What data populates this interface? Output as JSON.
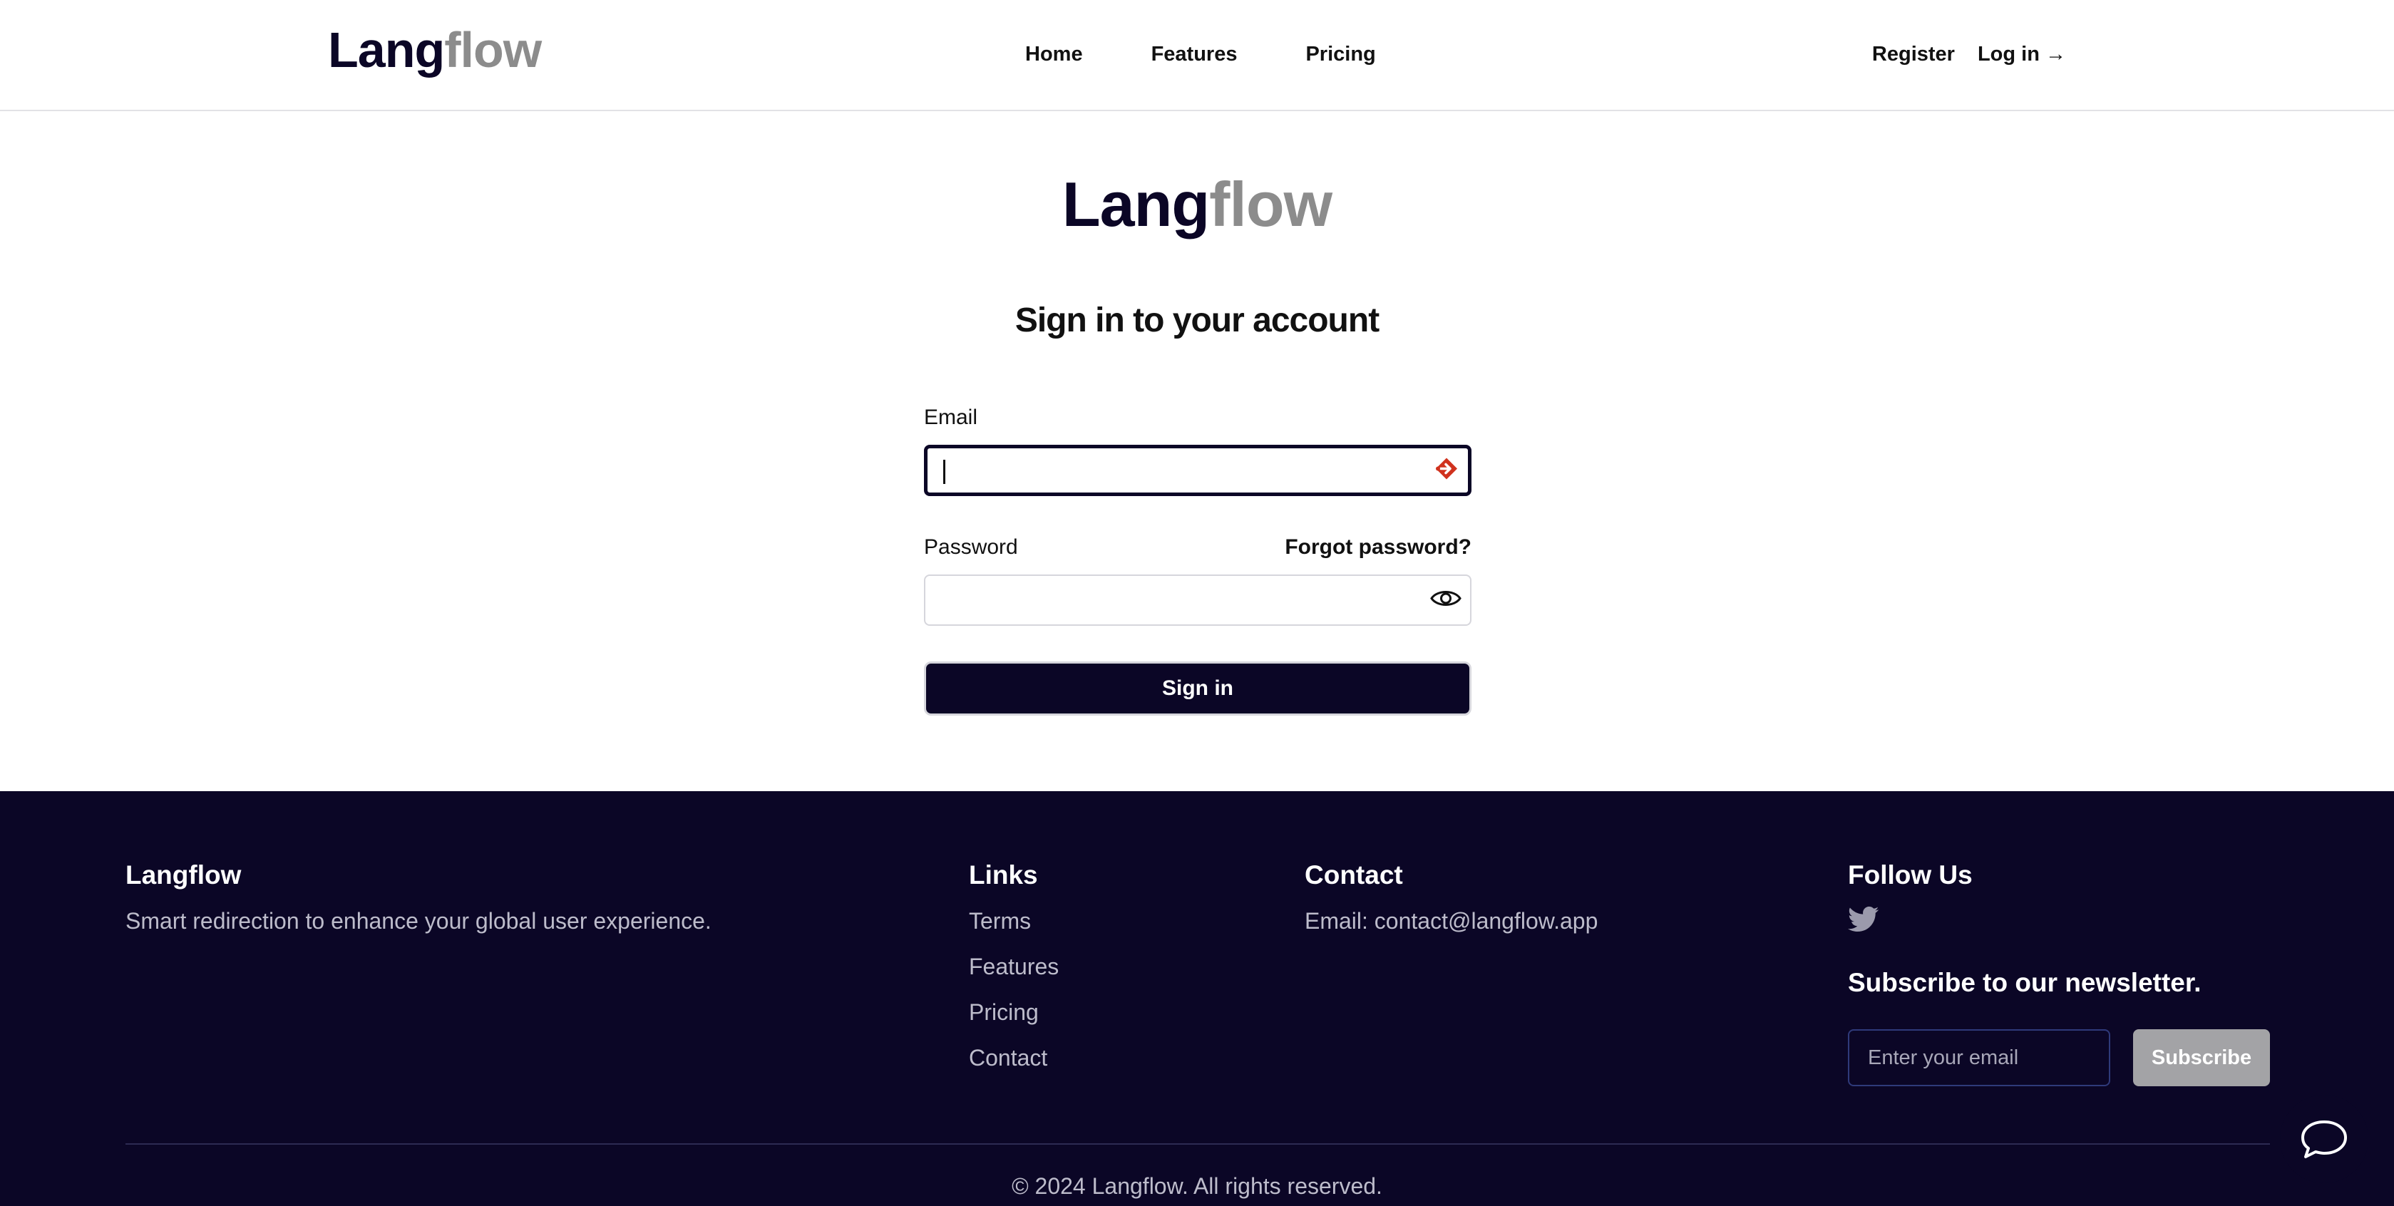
{
  "header": {
    "brand_part1": "Lang",
    "brand_part2": "flow",
    "nav": [
      "Home",
      "Features",
      "Pricing"
    ],
    "register": "Register",
    "login": "Log in →"
  },
  "login": {
    "logo_part1": "Lang",
    "logo_part2": "flow",
    "title": "Sign in to your account",
    "email_label": "Email",
    "email_value": "",
    "password_label": "Password",
    "password_value": "",
    "forgot": "Forgot password?",
    "submit": "Sign in"
  },
  "footer": {
    "brand": "Langflow",
    "tagline": "Smart redirection to enhance your global user experience.",
    "links_title": "Links",
    "links": [
      "Terms",
      "Features",
      "Pricing",
      "Contact"
    ],
    "contact_title": "Contact",
    "contact_email": "Email: contact@langflow.app",
    "follow_title": "Follow Us",
    "newsletter_title": "Subscribe to our newsletter.",
    "newsletter_placeholder": "Enter your email",
    "subscribe": "Subscribe",
    "copyright": "© 2024 Langflow. All rights reserved."
  },
  "icons": {
    "password_toggle": "eye-icon",
    "autofill": "password-manager-icon",
    "social": "twitter-icon",
    "chat": "chat-bubble-icon"
  },
  "colors": {
    "primary": "#0b0626",
    "muted_logo": "#8c8c8c",
    "autofill_icon": "#d0321e"
  }
}
